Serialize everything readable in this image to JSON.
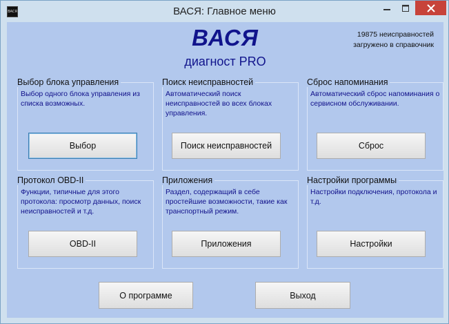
{
  "window": {
    "title": "ВАСЯ:  Главное меню",
    "icon_text": "ВАСЯ"
  },
  "brand": {
    "name": "ВАСЯ",
    "subtitle": "диагност PRO"
  },
  "faults_info": {
    "line1": "19875 неисправностей",
    "line2": "загружено в справочник"
  },
  "groups": [
    {
      "title": "Выбор блока управления",
      "description": "Выбор одного блока управления из списка возможных.",
      "button": "Выбор"
    },
    {
      "title": "Поиск неисправностей",
      "description": "Автоматический поиск неисправностей во всех блоках управления.",
      "button": "Поиск неисправностей"
    },
    {
      "title": "Сброс напоминания",
      "description": "Автоматический сброс напоминания о сервисном обслуживании.",
      "button": "Сброс"
    },
    {
      "title": "Протокол OBD-II",
      "description": "Функции, типичные для этого протокола: просмотр данных, поиск неисправностей и т.д.",
      "button": "OBD-II"
    },
    {
      "title": "Приложения",
      "description": "Раздел, содержащий в себе простейшие возможности, такие как транспортный режим.",
      "button": "Приложения"
    },
    {
      "title": "Настройки программы",
      "description": "Настройки подключения, протокола и т.д.",
      "button": "Настройки"
    }
  ],
  "footer": {
    "about_button": "О программе",
    "exit_button": "Выход"
  },
  "colors": {
    "client_background": "#b2c8ed",
    "brand_text": "#11148c",
    "description_text": "#10108a",
    "close_button": "#c7433a"
  }
}
